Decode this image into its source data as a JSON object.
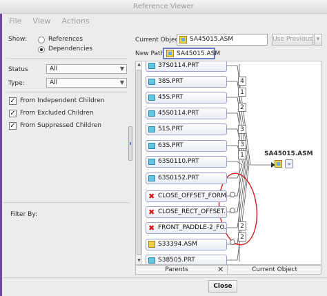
{
  "window": {
    "title": "Reference Viewer"
  },
  "menu": [
    "File",
    "View",
    "Actions"
  ],
  "show": {
    "label": "Show:",
    "options": [
      "References",
      "Dependencies"
    ],
    "selected": "Dependencies"
  },
  "filters": {
    "status_label": "Status",
    "status_value": "All",
    "type_label": "Type:",
    "type_value": "All"
  },
  "checkboxes": [
    {
      "label": "From Independent Children",
      "checked": true
    },
    {
      "label": "From Excluded Children",
      "checked": true
    },
    {
      "label": "From Suppressed Children",
      "checked": true
    }
  ],
  "filter_by_label": "Filter By:",
  "current_object": {
    "label": "Current Object:",
    "value": "SA45015.ASM",
    "use_previous": "Use Previous"
  },
  "new_path": {
    "label": "New Path:",
    "value": "SA45015.ASM"
  },
  "nodes": [
    {
      "name": "37S0114.PRT",
      "kind": "prt"
    },
    {
      "name": "38S.PRT",
      "kind": "prt"
    },
    {
      "name": "45S.PRT",
      "kind": "prt"
    },
    {
      "name": "45S0114.PRT",
      "kind": "prt"
    },
    {
      "name": "51S.PRT",
      "kind": "prt"
    },
    {
      "name": "63S.PRT",
      "kind": "prt"
    },
    {
      "name": "63S0110.PRT",
      "kind": "prt"
    },
    {
      "name": "63S0152.PRT",
      "kind": "prt"
    },
    {
      "name": "CLOSE_OFFSET_FORM...",
      "kind": "missing"
    },
    {
      "name": "CLOSE_RECT_OFFSET...",
      "kind": "missing"
    },
    {
      "name": "FRONT_PADDLE-2_FO...",
      "kind": "missing"
    },
    {
      "name": "S33394.ASM",
      "kind": "asm"
    },
    {
      "name": "S38505.PRT",
      "kind": "prt"
    }
  ],
  "badges": [
    "4",
    "1",
    "2",
    "3",
    "3",
    "1",
    "2",
    "2"
  ],
  "target": {
    "name": "SA45015.ASM"
  },
  "tabs": {
    "parents": "Parents",
    "current": "Current Object",
    "close_glyph": "✕"
  },
  "footer": {
    "close": "Close"
  },
  "colors": {
    "annotation_circle": "#d0201e",
    "selection_border": "#6a7bc8",
    "part_icon": "#62c6e3",
    "assembly_icon": "#f0cf48"
  }
}
